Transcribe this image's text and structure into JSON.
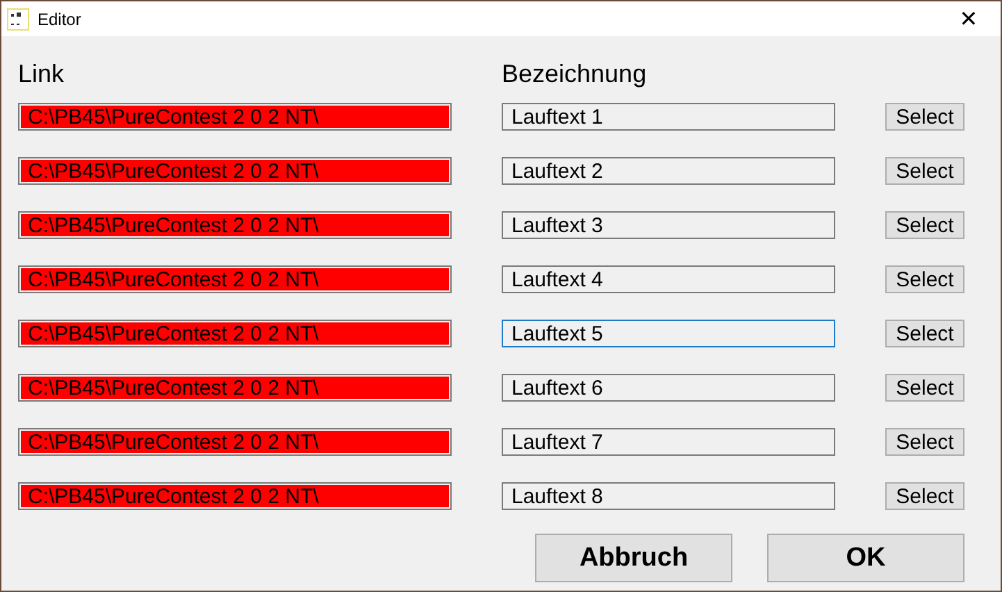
{
  "window": {
    "title": "Editor"
  },
  "headers": {
    "link": "Link",
    "name": "Bezeichnung"
  },
  "rows": [
    {
      "link": "C:\\PB45\\PureContest 2 0 2 NT\\",
      "name": "Lauftext 1",
      "focused": false,
      "button": "Select"
    },
    {
      "link": "C:\\PB45\\PureContest 2 0 2 NT\\",
      "name": "Lauftext 2",
      "focused": false,
      "button": "Select"
    },
    {
      "link": "C:\\PB45\\PureContest 2 0 2 NT\\",
      "name": "Lauftext 3",
      "focused": false,
      "button": "Select"
    },
    {
      "link": "C:\\PB45\\PureContest 2 0 2 NT\\",
      "name": "Lauftext 4",
      "focused": false,
      "button": "Select"
    },
    {
      "link": "C:\\PB45\\PureContest 2 0 2 NT\\",
      "name": "Lauftext 5",
      "focused": true,
      "button": "Select"
    },
    {
      "link": "C:\\PB45\\PureContest 2 0 2 NT\\",
      "name": "Lauftext 6",
      "focused": false,
      "button": "Select"
    },
    {
      "link": "C:\\PB45\\PureContest 2 0 2 NT\\",
      "name": "Lauftext 7",
      "focused": false,
      "button": "Select"
    },
    {
      "link": "C:\\PB45\\PureContest 2 0 2 NT\\",
      "name": "Lauftext 8",
      "focused": false,
      "button": "Select"
    }
  ],
  "buttons": [
    "Abbruch",
    "OK"
  ],
  "close": "✕"
}
